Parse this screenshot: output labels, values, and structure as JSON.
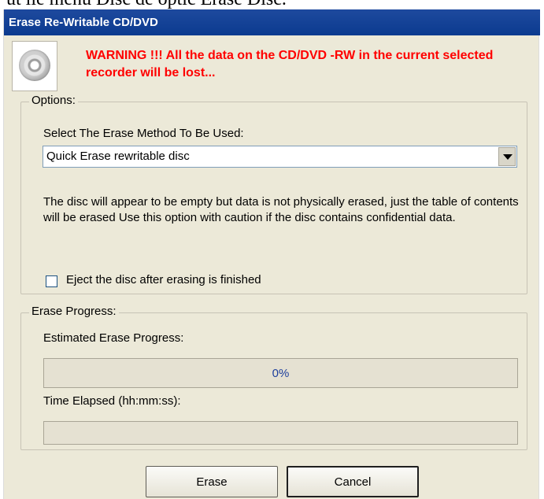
{
  "background_text": "ut lie menu Disc de optic Erase Disc.",
  "window": {
    "title": "Erase Re-Writable CD/DVD",
    "icon": "cd-disc-icon",
    "warning": "WARNING !!! All the data on the CD/DVD -RW in the current selected recorder will be lost..."
  },
  "options": {
    "legend": "Options:",
    "method_label": "Select The Erase Method To Be Used:",
    "method_selected": "Quick Erase rewritable disc",
    "description": "The disc will appear to be empty but data is not physically erased, just the table of contents will be erased Use this option with caution if the disc contains confidential data.",
    "eject_label": "Eject the disc after erasing is finished",
    "eject_checked": false
  },
  "progress": {
    "legend": "Erase Progress:",
    "estimated_label": "Estimated Erase Progress:",
    "percent_text": "0%",
    "percent_value": 0,
    "time_label": "Time Elapsed (hh:mm:ss):",
    "time_value": ""
  },
  "buttons": {
    "erase": "Erase",
    "cancel": "Cancel"
  },
  "colors": {
    "title_bar": "#0b3a8f",
    "warning_text": "#ff0000",
    "dialog_bg": "#ece9d8",
    "progress_text": "#1e3f9c"
  }
}
